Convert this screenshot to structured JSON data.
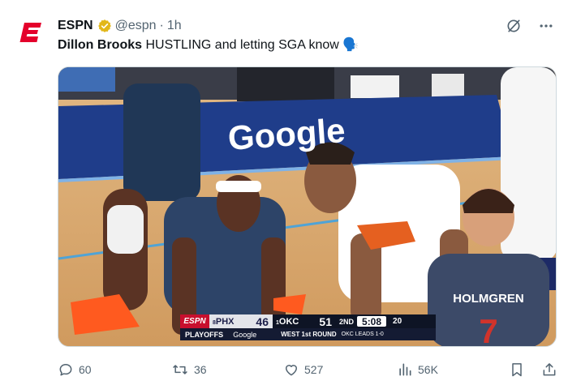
{
  "tweet": {
    "author_name": "ESPN",
    "handle": "@espn",
    "separator": "·",
    "time": "1h",
    "text_bold": "Dillon Brooks",
    "text_rest": " HUSTLING and letting SGA know ",
    "text_emoji": "🗣️"
  },
  "media": {
    "court_banner": "Google",
    "jersey_name": "HOLMGREN",
    "jersey_number": "7",
    "scorebug": {
      "network": "ESPN",
      "team1_seed": "8",
      "team1": "PHX",
      "team1_score": "46",
      "team2_seed": "1",
      "team2": "OKC",
      "team2_score": "51",
      "quarter": "2ND",
      "clock": "5:08",
      "shot_clock": "20",
      "playoffs": "PLAYOFFS",
      "sponsor": "Google",
      "round": "WEST 1st ROUND",
      "series": "OKC LEADS 1-0"
    }
  },
  "actions": {
    "replies": "60",
    "reposts": "36",
    "likes": "527",
    "views": "56K"
  },
  "colors": {
    "espn_red": "#e4002b",
    "verified_gold": "#e2b719",
    "muted": "#536471"
  }
}
